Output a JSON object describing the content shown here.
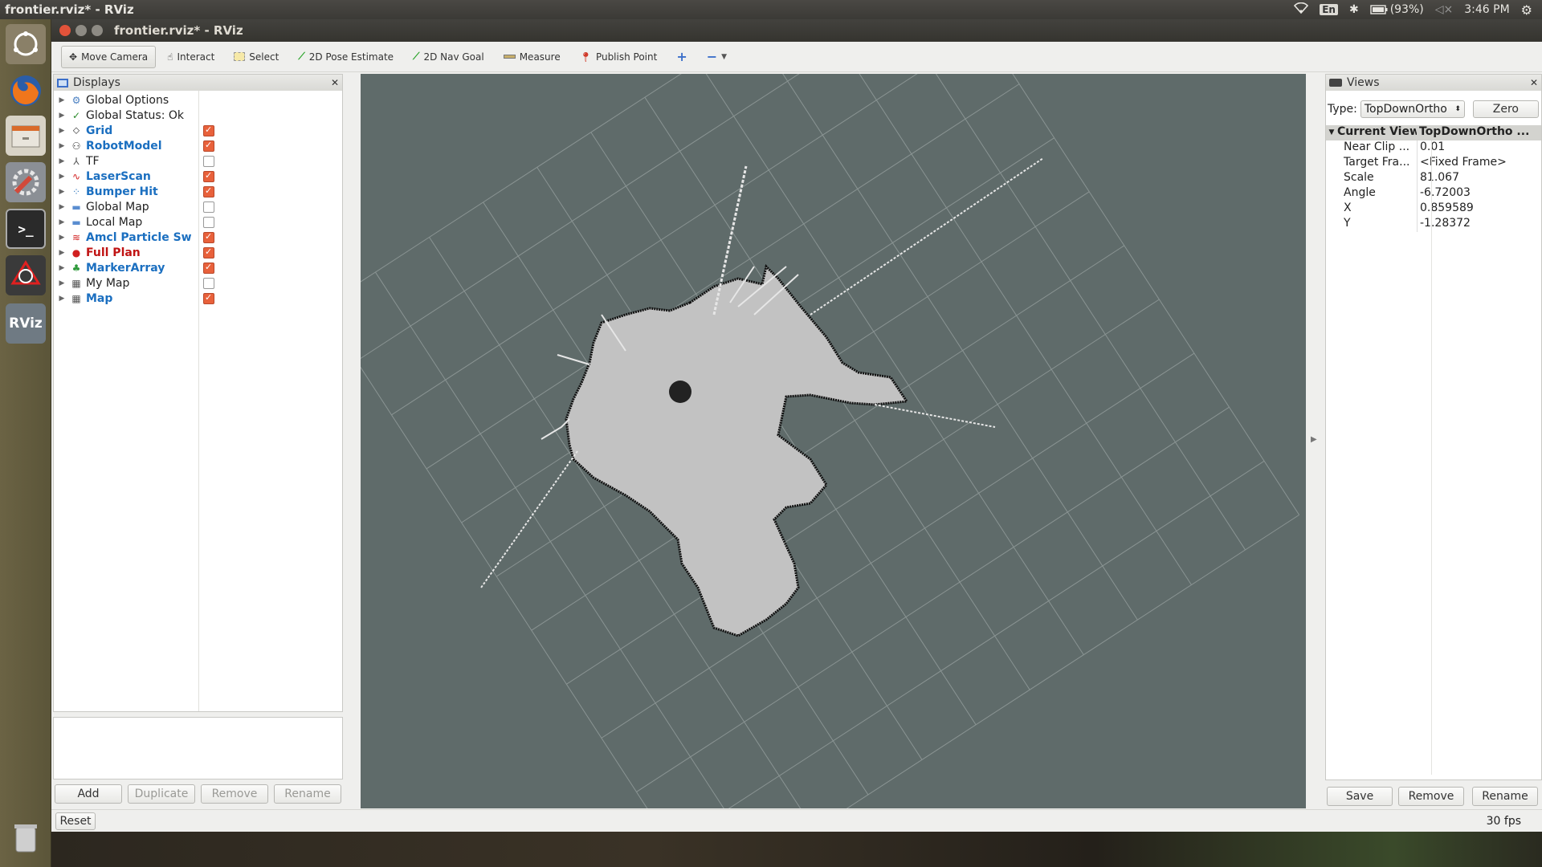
{
  "system": {
    "title": "frontier.rviz* - RViz",
    "keyboard": "En",
    "battery": "(93%)",
    "time": "3:46 PM"
  },
  "window": {
    "title": "frontier.rviz* - RViz"
  },
  "toolbar": {
    "move_camera": "Move Camera",
    "interact": "Interact",
    "select": "Select",
    "pose_estimate": "2D Pose Estimate",
    "nav_goal": "2D Nav Goal",
    "measure": "Measure",
    "publish_point": "Publish Point"
  },
  "displays": {
    "title": "Displays",
    "items": [
      {
        "label": "Global Options",
        "icon": "gear-icon",
        "style": "normal",
        "checkbox": "none"
      },
      {
        "label": "Global Status: Ok",
        "icon": "check-icon",
        "style": "normal",
        "checkbox": "none"
      },
      {
        "label": "Grid",
        "icon": "grid-icon",
        "style": "blue",
        "checkbox": "on"
      },
      {
        "label": "RobotModel",
        "icon": "robot-icon",
        "style": "blue",
        "checkbox": "on"
      },
      {
        "label": "TF",
        "icon": "tf-icon",
        "style": "normal",
        "checkbox": "off"
      },
      {
        "label": "LaserScan",
        "icon": "laser-icon",
        "style": "blue",
        "checkbox": "on"
      },
      {
        "label": "Bumper Hit",
        "icon": "points-icon",
        "style": "blue",
        "checkbox": "on"
      },
      {
        "label": "Global Map",
        "icon": "folder-icon",
        "style": "normal",
        "checkbox": "off"
      },
      {
        "label": "Local Map",
        "icon": "folder-icon",
        "style": "normal",
        "checkbox": "off"
      },
      {
        "label": "Amcl Particle Sw...",
        "icon": "pose-array-icon",
        "style": "blue",
        "checkbox": "on"
      },
      {
        "label": "Full Plan",
        "icon": "stop-icon",
        "style": "red",
        "checkbox": "on"
      },
      {
        "label": "MarkerArray",
        "icon": "marker-icon",
        "style": "blue",
        "checkbox": "on"
      },
      {
        "label": "My Map",
        "icon": "map-icon",
        "style": "normal",
        "checkbox": "off"
      },
      {
        "label": "Map",
        "icon": "map-icon",
        "style": "blue",
        "checkbox": "on"
      }
    ],
    "add": "Add",
    "duplicate": "Duplicate",
    "remove": "Remove",
    "rename": "Rename"
  },
  "status": {
    "reset": "Reset",
    "fps": "30 fps"
  },
  "views": {
    "title": "Views",
    "type_label": "Type:",
    "type_value": "TopDownOrtho",
    "zero": "Zero",
    "current_view_key": "Current View",
    "current_view_value": "TopDownOrtho ...",
    "props": [
      {
        "k": "Near Clip ...",
        "v": "0.01"
      },
      {
        "k": "Target Fra...",
        "v": "<Fixed Frame>"
      },
      {
        "k": "Scale",
        "v": "81.067"
      },
      {
        "k": "Angle",
        "v": "-6.72003"
      },
      {
        "k": "X",
        "v": "0.859589"
      },
      {
        "k": "Y",
        "v": "-1.28372"
      }
    ],
    "save": "Save",
    "remove": "Remove",
    "rename": "Rename"
  },
  "colors": {
    "viewport_bg": "#5f6b6a",
    "map_free": "#c2c2c2",
    "accent_checkbox": "#e8613b"
  }
}
